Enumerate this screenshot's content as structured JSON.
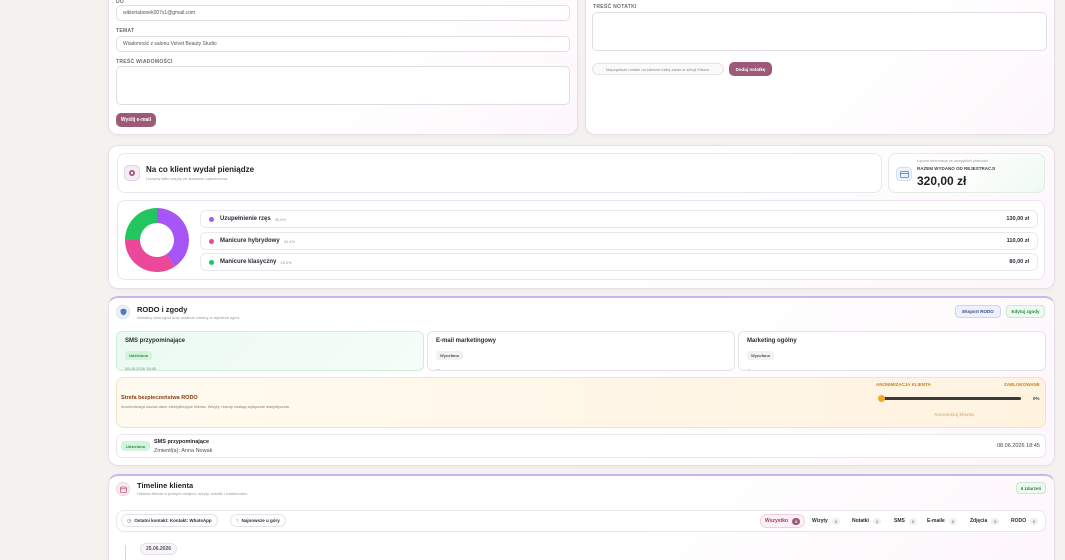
{
  "email_form": {
    "email_label": "DO",
    "email_value": "wiktoriabonek007x1@gmail.com",
    "subject_label": "TEMAT",
    "subject_value": "Wiadomość z salonu Velvet Beauty Studio",
    "message_label": "TREŚĆ WIADOMOŚCI",
    "send_button": "Wyślij e-mail"
  },
  "note_form": {
    "label": "TREŚĆ NOTATKI",
    "hint": "Najczęstsze notatki na kliencie trafią zaraz w sekcji Klienci.",
    "save_button": "Dodaj notatkę"
  },
  "spending": {
    "title": "Na co klient wydał pieniądze",
    "subtitle": "Liczymy tylko wizyty ze statusem zakończona.",
    "side_hint": "Łączne informacje ze wszystkich płatności",
    "total_label": "RAZEM WYDANO OD REJESTRACJI",
    "total_value": "320,00 zł",
    "categories": [
      {
        "name": "Uzupełnienie rzęs",
        "pct": "40,6%",
        "amount": "130,00 zł",
        "color": "#a855f7"
      },
      {
        "name": "Manicure hybrydowy",
        "pct": "34,4%",
        "amount": "110,00 zł",
        "color": "#ec4899"
      },
      {
        "name": "Manicure klasyczny",
        "pct": "25,0%",
        "amount": "80,00 zł",
        "color": "#22c55e"
      }
    ],
    "chart_data": {
      "type": "pie",
      "categories": [
        "Uzupełnienie rzęs",
        "Manicure hybrydowy",
        "Manicure klasyczny"
      ],
      "values": [
        130,
        110,
        80
      ],
      "colors": [
        "#a855f7",
        "#ec4899",
        "#22c55e"
      ]
    }
  },
  "rodo": {
    "title": "RODO i zgody",
    "subtitle": "Aktualny stan zgód oraz ostatnie zmiany w rejestrze zgód.",
    "export_button": "Eksport RODO",
    "edit_button": "Edytuj zgody",
    "consents": [
      {
        "title": "SMS przypominające",
        "status": "Udzielona",
        "date": "08.06.2026 18:45"
      },
      {
        "title": "E-mail marketingowy",
        "status": "Wycofana",
        "date": "—"
      },
      {
        "title": "Marketing ogólny",
        "status": "Wycofana",
        "date": "—"
      }
    ],
    "safety": {
      "title": "Strefa bezpieczeństwa RODO",
      "desc": "Anonimizacja usuwa dane identyfikujące klienta. Wizyty i kwoty zostają wyłącznie statystycznie.",
      "anon_label": "ANONIMIZACJA KLIENTA",
      "blocked_label": "ZABLOKOWANE",
      "progress_text": "0%",
      "progress_value": 0,
      "anon_button": "Anonimizuj klienta"
    },
    "history": {
      "badge": "Udzielona",
      "title": "SMS przypominające",
      "changed_by": "Zmienił(a): Anna Nowak",
      "date": "08.06.2026 18:45"
    }
  },
  "timeline": {
    "title": "Timeline klienta",
    "subtitle": "Historia klienta w jednym miejscu: wizyty, notatki i wiadomości.",
    "count_badge": "6 zdarzeń",
    "last_contact": "Ostatni kontakt: Kontakt: WhatsApp",
    "sort_label": "Najnowsze u góry",
    "filters": [
      {
        "label": "Wszystko",
        "count": "6"
      },
      {
        "label": "Wizyty",
        "count": "4"
      },
      {
        "label": "Notatki",
        "count": "2"
      },
      {
        "label": "SMS",
        "count": "0"
      },
      {
        "label": "E-maile",
        "count": "0"
      },
      {
        "label": "Zdjęcia",
        "count": "0"
      },
      {
        "label": "RODO",
        "count": "0"
      }
    ],
    "date_marker": "25.06.2026"
  }
}
